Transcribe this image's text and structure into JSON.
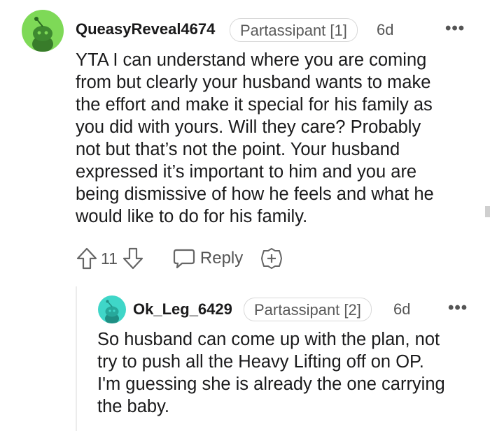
{
  "comment": {
    "username": "QueasyReveal4674",
    "flair": "Partassipant [1]",
    "age": "6d",
    "more_label": "•••",
    "lines": [
      "YTA I can understand where you are coming",
      "from but clearly your husband wants to make",
      "the effort and make it special for his family as",
      "you did with yours. Will they care? Probably",
      "not but that’s not the point. Your husband",
      "expressed it’s important to him and you are",
      "being dismissive of how he feels and what he",
      "would like to do for his family."
    ],
    "vote_count": "11",
    "reply_label": "Reply",
    "avatar_color": "#7ed957"
  },
  "reply": {
    "username": "Ok_Leg_6429",
    "flair": "Partassipant [2]",
    "age": "6d",
    "more_label": "•••",
    "lines": [
      "So husband can come up with the plan, not",
      "try to push all the Heavy Lifting off on OP.",
      "I'm guessing she is already the one carrying",
      "the baby."
    ],
    "avatar_color": "#3fd6c8"
  },
  "icons": {
    "upvote": "arrow-up-outline",
    "downvote": "arrow-down-outline",
    "reply": "speech-bubble-outline",
    "award": "plus-shield-outline",
    "more": "horizontal-dots"
  }
}
